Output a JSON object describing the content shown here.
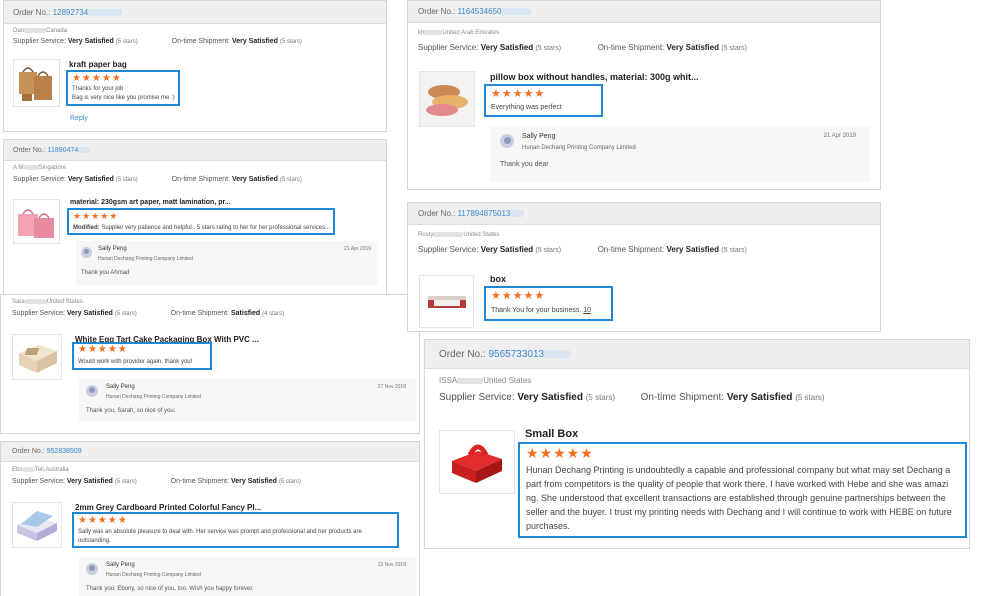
{
  "labels": {
    "order_no": "Order No.:",
    "supplier_service": "Supplier Service:",
    "ontime_shipment": "On-time Shipment:",
    "very_satisfied": "Very Satisfied",
    "satisfied": "Satisfied",
    "five_stars": "(5 stars)",
    "four_stars": "(4 stars)",
    "reply": "Reply",
    "star_rating": "★★★★★"
  },
  "colors": {
    "accent_blue": "#1e88d6",
    "star_orange": "#f36f21",
    "link_blue": "#3a86c8"
  },
  "reviews": [
    {
      "order_no": "12892734",
      "buyer": "Dan",
      "country": "Canada",
      "supplier_rating": "Very Satisfied",
      "supplier_stars": "(5 stars)",
      "shipment_rating": "Very Satisfied",
      "shipment_stars": "(5 stars)",
      "product": "kraft paper bag",
      "stars": 5,
      "comment_line1": "Thanks for your job",
      "comment_line2": "Bag is very nice like you promise me :)",
      "reply_link": "Reply"
    },
    {
      "order_no": "11890474",
      "buyer": "A Mi",
      "country": "Singapore",
      "supplier_rating": "Very Satisfied",
      "supplier_stars": "(5 stars)",
      "shipment_rating": "Very Satisfied",
      "shipment_stars": "(5 stars)",
      "product": "material: 230gsm art paper, matt lamination, pr...",
      "stars": 5,
      "comment_prefix": "Modified:",
      "comment": "Supplier very patience and helpful . 5 stars rating to her for her professional services...",
      "reply": {
        "name": "Sally Peng",
        "company": "Hunan Dechang Printing Company Limited",
        "date": "21 Apr 2019",
        "message": "Thank you Ahmad"
      }
    },
    {
      "buyer": "Sara",
      "country": "United States",
      "supplier_rating": "Very Satisfied",
      "supplier_stars": "(5 stars)",
      "shipment_rating": "Satisfied",
      "shipment_stars": "(4 stars)",
      "product": "White Egg Tart Cake Packaging Box With PVC ...",
      "stars": 5,
      "comment": "Would work with provider again, thank you!",
      "reply": {
        "name": "Sally Peng",
        "company": "Hunan Dechang Printing Company Limited",
        "date": "27 Nov 2018",
        "message": "Thank you, Sarah, so nice of you."
      }
    },
    {
      "order_no": "952838509",
      "buyer": "Ebo",
      "country": "Tell,Australia",
      "supplier_rating": "Very Satisfied",
      "supplier_stars": "(5 stars)",
      "shipment_rating": "Very Satisfied",
      "shipment_stars": "(5 stars)",
      "product": "2mm Grey Cardboard Printed Colorful Fancy Pl...",
      "stars": 5,
      "comment_line1": "Sally was an absolute pleasure to deal with. Her service was prompt and professional and her products are",
      "comment_line2": "outstanding.",
      "reply": {
        "name": "Sally Peng",
        "company": "Hunan Dechang Printing Company Limited",
        "date": "13 Nov 2018",
        "message": "Thank you, Ebony, so nice of you, too. Wish you happy forever."
      }
    },
    {
      "order_no": "1164534650",
      "buyer": "kh",
      "country": "United Arab Emirates",
      "supplier_rating": "Very Satisfied",
      "supplier_stars": "(5 stars)",
      "shipment_rating": "Very Satisfied",
      "shipment_stars": "(5 stars)",
      "product": "pillow box without handles, material: 300g whit...",
      "stars": 5,
      "comment": "Everything was perfect",
      "reply": {
        "name": "Sally Peng",
        "company": "Hunan Dechang Printing Company Limited",
        "date": "21 Apr 2019",
        "message": "Thank you dear"
      }
    },
    {
      "order_no": "117894875013",
      "buyer": "Rosty",
      "country": "United States",
      "supplier_rating": "Very Satisfied",
      "supplier_stars": "(5 stars)",
      "shipment_rating": "Very Satisfied",
      "shipment_stars": "(5 stars)",
      "product": "box",
      "stars": 5,
      "comment": "Thank You for your business.",
      "comment_suffix": "10"
    },
    {
      "order_no": "9565733013",
      "buyer": "ISSA",
      "country": "United States",
      "supplier_rating": "Very Satisfied",
      "supplier_stars": "(5 stars)",
      "shipment_rating": "Very Satisfied",
      "shipment_stars": "(5 stars)",
      "product": "Small Box",
      "stars": 5,
      "comment_lines": [
        "Hunan Dechang Printing is undoubtedly a capable and professional company but what may set Dechang a",
        "part from competitors is the quality of people that work there. I have worked with Hebe and she was amazi",
        "ng.  She understood that excellent transactions are established through genuine partnerships between the",
        "seller and the buyer.  I trust my printing needs with Dechang and I will continue to work with HEBE on future",
        "purchases."
      ]
    }
  ]
}
